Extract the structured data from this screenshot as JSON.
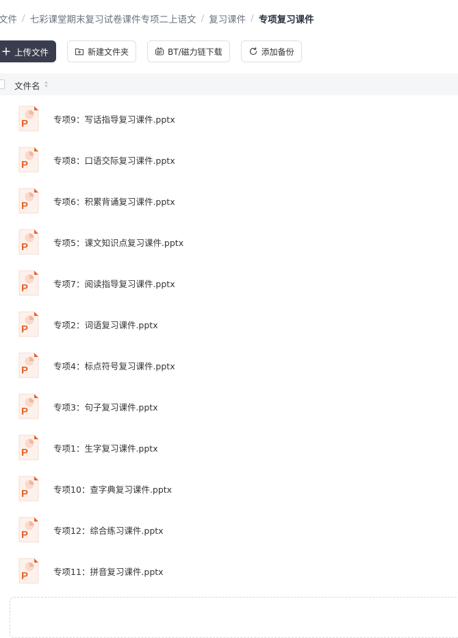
{
  "breadcrumb": {
    "items": [
      "文件",
      "七彩课堂期末复习试卷课件专项二上语文",
      "复习课件"
    ],
    "separator": "/",
    "current": "专项复习课件"
  },
  "toolbar": {
    "upload_label": "上传文件",
    "new_folder_label": "新建文件夹",
    "bt_download_label": "BT/磁力链下载",
    "add_backup_label": "添加备份"
  },
  "list": {
    "header": {
      "name_column": "文件名"
    },
    "files": [
      {
        "name": "专项9：写话指导复习课件.pptx",
        "icon": "pptx-file-icon"
      },
      {
        "name": "专项8：口语交际复习课件.pptx",
        "icon": "pptx-file-icon"
      },
      {
        "name": "专项6：积累背诵复习课件.pptx",
        "icon": "pptx-file-icon"
      },
      {
        "name": "专项5：课文知识点复习课件.pptx",
        "icon": "pptx-file-icon"
      },
      {
        "name": "专项7：阅读指导复习课件.pptx",
        "icon": "pptx-file-icon"
      },
      {
        "name": "专项2：词语复习课件.pptx",
        "icon": "pptx-file-icon"
      },
      {
        "name": "专项4：标点符号复习课件.pptx",
        "icon": "pptx-file-icon"
      },
      {
        "name": "专项3：句子复习课件.pptx",
        "icon": "pptx-file-icon"
      },
      {
        "name": "专项1：生字复习课件.pptx",
        "icon": "pptx-file-icon"
      },
      {
        "name": "专项10：查字典复习课件.pptx",
        "icon": "pptx-file-icon"
      },
      {
        "name": "专项12：综合练习课件.pptx",
        "icon": "pptx-file-icon"
      },
      {
        "name": "专项11：拼音复习课件.pptx",
        "icon": "pptx-file-icon"
      }
    ]
  },
  "colors": {
    "primary_button": "#3a3d4d",
    "pptx_orange": "#e8622a",
    "header_bg": "#f5f6f7"
  }
}
